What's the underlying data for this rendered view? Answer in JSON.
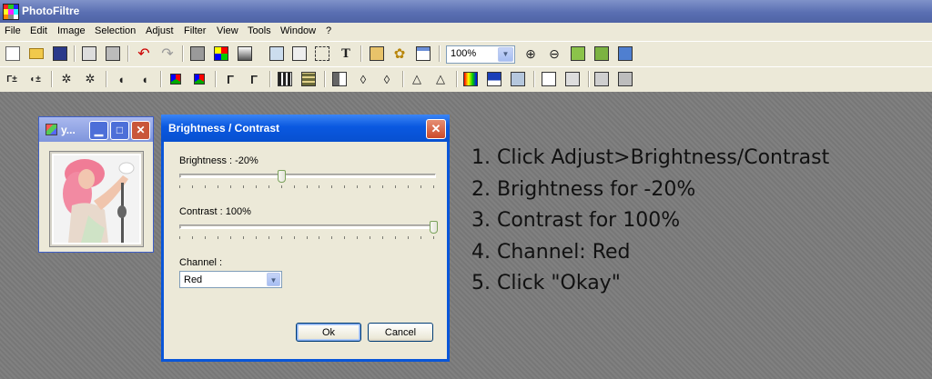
{
  "app": {
    "title": "PhotoFiltre"
  },
  "menu": [
    "File",
    "Edit",
    "Image",
    "Selection",
    "Adjust",
    "Filter",
    "View",
    "Tools",
    "Window",
    "?"
  ],
  "toolbar": {
    "zoom_value": "100%",
    "row1_icons": [
      "new-icon",
      "open-icon",
      "save-icon",
      "print-icon",
      "scan-icon",
      "undo-icon",
      "redo-icon",
      "paste-icon",
      "color-grid-icon",
      "gradient-icon",
      "select-icon",
      "text-icon",
      "layers-icon",
      "automate-icon",
      "window-icon",
      "zoom-in-icon",
      "zoom-out-icon",
      "fit-icon",
      "fullscreen-icon",
      "monitor-icon"
    ],
    "row2_icons": [
      "auto-levels-icon",
      "auto-contrast-icon",
      "brightness-down-icon",
      "brightness-up-icon",
      "contrast-down-icon",
      "contrast-up-icon",
      "saturation-down-icon",
      "saturation-up-icon",
      "gamma-down-icon",
      "gamma-up-icon",
      "grid-icon",
      "pattern-icon",
      "mirror-icon",
      "drop-icon",
      "drops-icon",
      "triangle-icon",
      "triangles-icon",
      "color-rect-icon",
      "monitor-color-icon",
      "effect-icon",
      "book-icon",
      "frame-icon",
      "transform-icon",
      "shear-icon"
    ]
  },
  "image_window": {
    "title": "y..."
  },
  "dialog": {
    "title": "Brightness / Contrast",
    "brightness_label": "Brightness : -20%",
    "brightness_value": -20,
    "contrast_label": "Contrast : 100%",
    "contrast_value": 100,
    "channel_label": "Channel :",
    "channel_value": "Red",
    "ok_label": "Ok",
    "cancel_label": "Cancel"
  },
  "instructions": [
    "1. Click Adjust>Brightness/Contrast",
    "2. Brightness for -20%",
    "3. Contrast for 100%",
    "4. Channel: Red",
    "5. Click \"Okay\""
  ],
  "colors": {
    "title_blue": "#0a56d8",
    "workspace": "#7c7c7c",
    "chrome": "#ece9d8"
  }
}
